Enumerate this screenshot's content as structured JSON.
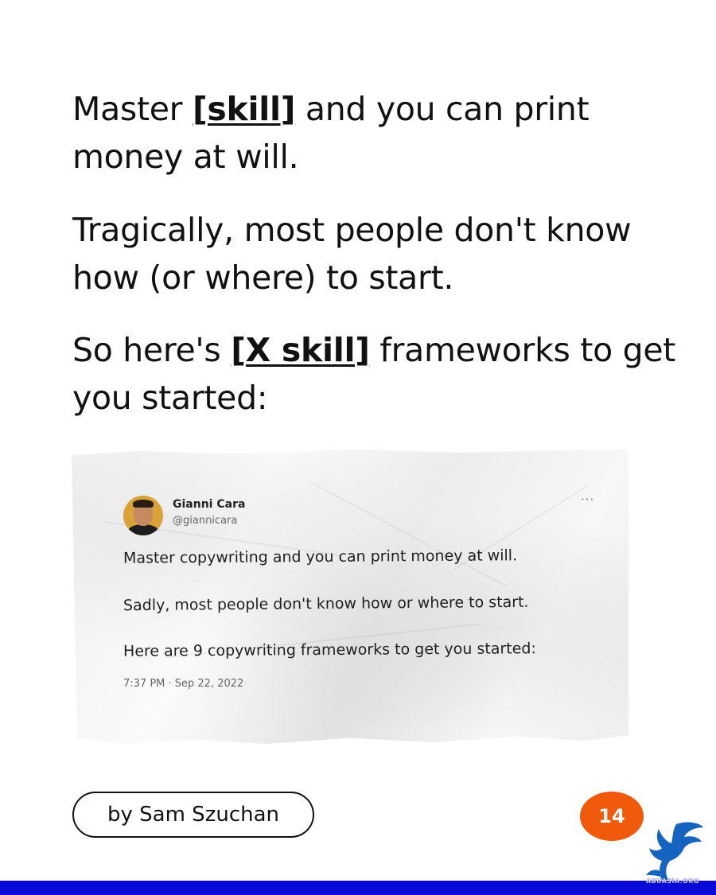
{
  "headline": {
    "p1": {
      "pre": "Master ",
      "bold": "[skill]",
      "post": " and you can print money at will."
    },
    "p2": "Tragically, most people don't know how (or where) to start.",
    "p3": {
      "pre": "So here's ",
      "bold": "[X skill]",
      "post": " frameworks to get you started:"
    }
  },
  "tweet": {
    "name": "Gianni Cara",
    "handle": "@giannicara",
    "more": "···",
    "line1": "Master copywriting and you can print money at will.",
    "line2": "Sadly, most people don't know how or where to start.",
    "line3": "Here are 9 copywriting frameworks to get you started:",
    "timestamp": "7:37 PM · Sep 22, 2022"
  },
  "byline": "by Sam Szuchan",
  "page_number": "14",
  "watermark": "ABUASIA.ORG",
  "colors": {
    "accent": "#f15a0a",
    "bottom_bar": "#0a0ad8",
    "logo": "#1565c0"
  }
}
